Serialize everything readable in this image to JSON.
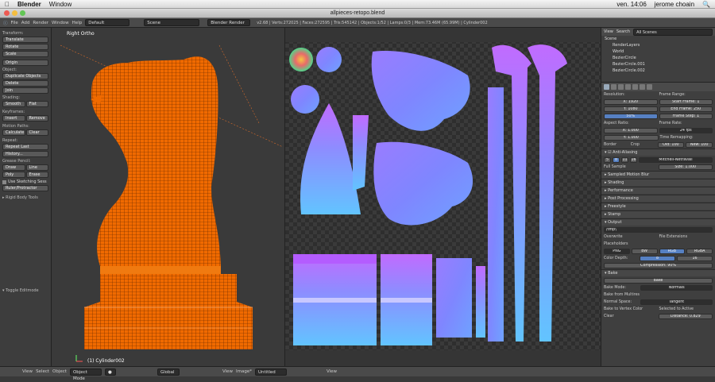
{
  "menubar": {
    "app": "Blender",
    "window": "Window",
    "time": "ven. 14:06",
    "user": "jerome choain"
  },
  "title": "allpieces-retopo.blend",
  "info": {
    "file": "File",
    "add": "Add",
    "render": "Render",
    "window": "Window",
    "help": "Help",
    "layout": "Default",
    "scene": "Scene",
    "engine": "Blender Render",
    "stats": "v2.68 | Verts:272025 | Faces:272595 | Tris:545142 | Objects:1/52 | Lamps:0/3 | Mem:73.46M (65.99M) | Cylinder002"
  },
  "shelf": {
    "transform": "Transform:",
    "translate": "Translate",
    "rotate": "Rotate",
    "scale": "Scale",
    "origin": "Origin",
    "object": "Object:",
    "duplicate": "Duplicate Objects",
    "delete": "Delete",
    "join": "Join",
    "shading": "Shading:",
    "smooth": "Smooth",
    "flat": "Flat",
    "keyframes": "Keyframes:",
    "insert": "Insert",
    "remove": "Remove",
    "motion": "Motion Paths:",
    "calculate": "Calculate",
    "clear": "Clear",
    "repeat": "Repeat:",
    "repeat_last": "Repeat Last",
    "history": "History...",
    "grease": "Grease Pencil:",
    "draw": "Draw",
    "line": "Line",
    "poly": "Poly",
    "erase": "Erase",
    "sketch": "Use Sketching Sess",
    "ruler": "Ruler/Protractor",
    "rigid": "Rigid Body Tools",
    "toggle": "Toggle Editmode"
  },
  "view3d": {
    "label": "Right Ortho",
    "object": "(1) Cylinder002"
  },
  "outliner": {
    "view": "View",
    "search": "Search",
    "scenes": "All Scenes",
    "rows": [
      "Scene",
      "RenderLayers",
      "World",
      "BezierCircle",
      "BezierCircle.001",
      "BezierCircle.002"
    ]
  },
  "props": {
    "resolution": "Resolution:",
    "res_x": "X: 1920",
    "res_y": "Y: 1080",
    "res_pct": "50%",
    "frame_range": "Frame Range:",
    "start": "Start Frame: 1",
    "end": "End Frame: 250",
    "step": "Frame Step: 1",
    "aspect": "Aspect Ratio:",
    "asp_x": "X: 1.000",
    "asp_y": "Y: 1.000",
    "frame_rate": "Frame Rate:",
    "fps": "24 fps",
    "time_remap": "Time Remapping:",
    "old": "Old: 100",
    "new": "New: 100",
    "border": "Border",
    "crop": "Crop",
    "aa": "Anti-Aliasing",
    "aa_vals": [
      "5",
      "8",
      "11",
      "16"
    ],
    "filter": "Mitchell-Netravali",
    "full_sample": "Full Sample",
    "size": "Size: 1.000",
    "panels": [
      "Sampled Motion Blur",
      "Shading",
      "Performance",
      "Post Processing",
      "Freestyle",
      "Stamp"
    ],
    "output": "Output",
    "path": "/tmp\\",
    "overwrite": "Overwrite",
    "file_ext": "File Extensions",
    "placeholders": "Placeholders",
    "format": "PNG",
    "bw": "BW",
    "rgb": "RGB",
    "rgba": "RGBA",
    "depth": "Color Depth:",
    "d8": "8",
    "d16": "16",
    "compression": "Compression: 90%",
    "bake": "Bake",
    "bake_btn": "Bake",
    "bake_mode": "Bake Mode:",
    "normals": "Normals",
    "multires": "Bake from Multires",
    "normal_space": "Normal Space:",
    "tangent": "Tangent",
    "vertex_color": "Bake to Vertex Color",
    "selected_active": "Selected to Active",
    "clear": "Clear",
    "distance": "Distance: 0.829"
  },
  "bottom": {
    "view": "View",
    "select": "Select",
    "object": "Object",
    "mode": "Object Mode",
    "global": "Global",
    "view2": "View",
    "image": "Image*",
    "untitled": "Untitled",
    "view3": "View"
  }
}
